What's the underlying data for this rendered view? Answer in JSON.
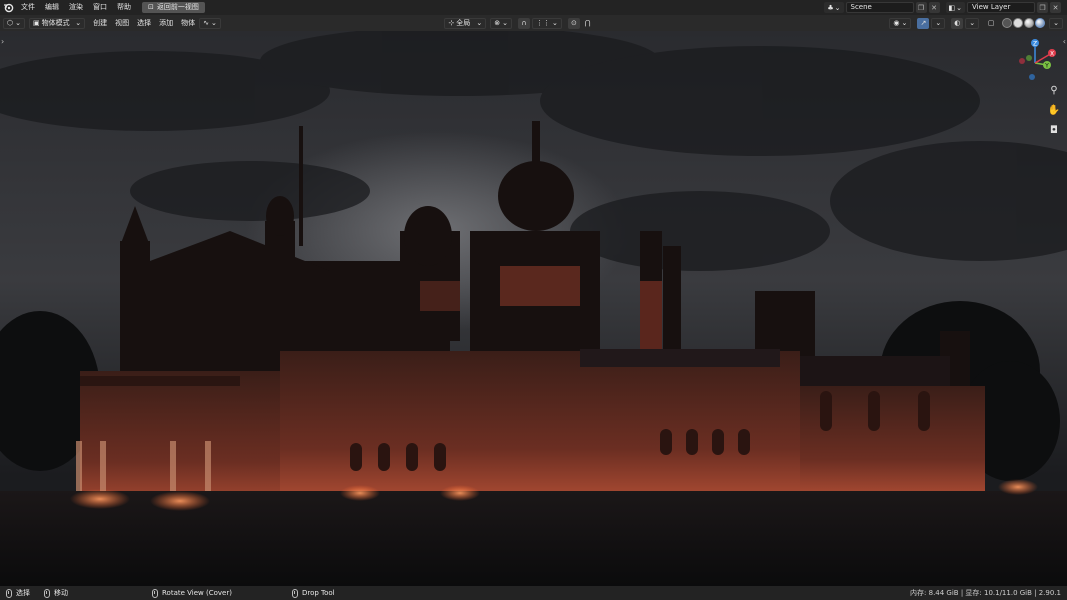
{
  "menubar": {
    "items": [
      "文件",
      "编辑",
      "渲染",
      "窗口",
      "帮助"
    ],
    "back_button": "返回前一视图",
    "scene_name": "Scene",
    "view_layer_name": "View Layer"
  },
  "viewport_header": {
    "mode": "物体模式",
    "menus": [
      "创建",
      "视图",
      "选择",
      "添加",
      "物体"
    ],
    "transform_orientation": "全局"
  },
  "gizmo": {
    "axis_z": "Z",
    "axis_y": "Y",
    "axis_x": "X"
  },
  "statusbar": {
    "select": "选择",
    "move": "移动",
    "rotate_view": "Rotate View (Cover)",
    "drop_tool": "Drop Tool",
    "stats": "内存: 8.44 GiB | 显存: 10.1/11.0 GiB | 2.90.1"
  },
  "colors": {
    "accent_blue": "#4a6fa0",
    "axis_x": "#e03c4c",
    "axis_y": "#7ac143",
    "axis_z": "#3c8ce0"
  }
}
